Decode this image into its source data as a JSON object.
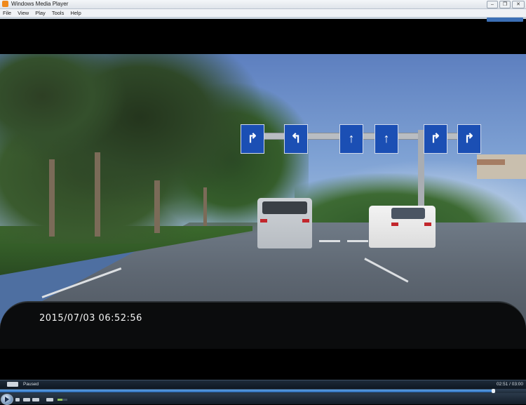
{
  "window": {
    "title": "Windows Media Player",
    "buttons": {
      "minimize": "–",
      "restore": "❐",
      "close": "✕"
    }
  },
  "menu": {
    "items": [
      "File",
      "View",
      "Play",
      "Tools",
      "Help"
    ]
  },
  "video": {
    "timestamp": "2015/07/03 06:52:56",
    "sign_glyphs": [
      "↱",
      "↰",
      "↑",
      "↑",
      "↑",
      "↱",
      "↱"
    ]
  },
  "status": {
    "state": "Paused",
    "time": "02:51 / 03:00"
  },
  "playback": {
    "progress_fraction": 0.95,
    "volume_fraction": 0.5
  },
  "colors": {
    "accent": "#2c6bb7",
    "sign_blue": "#1b4fb4",
    "volume": "#8fc15a"
  },
  "icons": {
    "play": "play-icon",
    "app": "media-player-icon"
  }
}
